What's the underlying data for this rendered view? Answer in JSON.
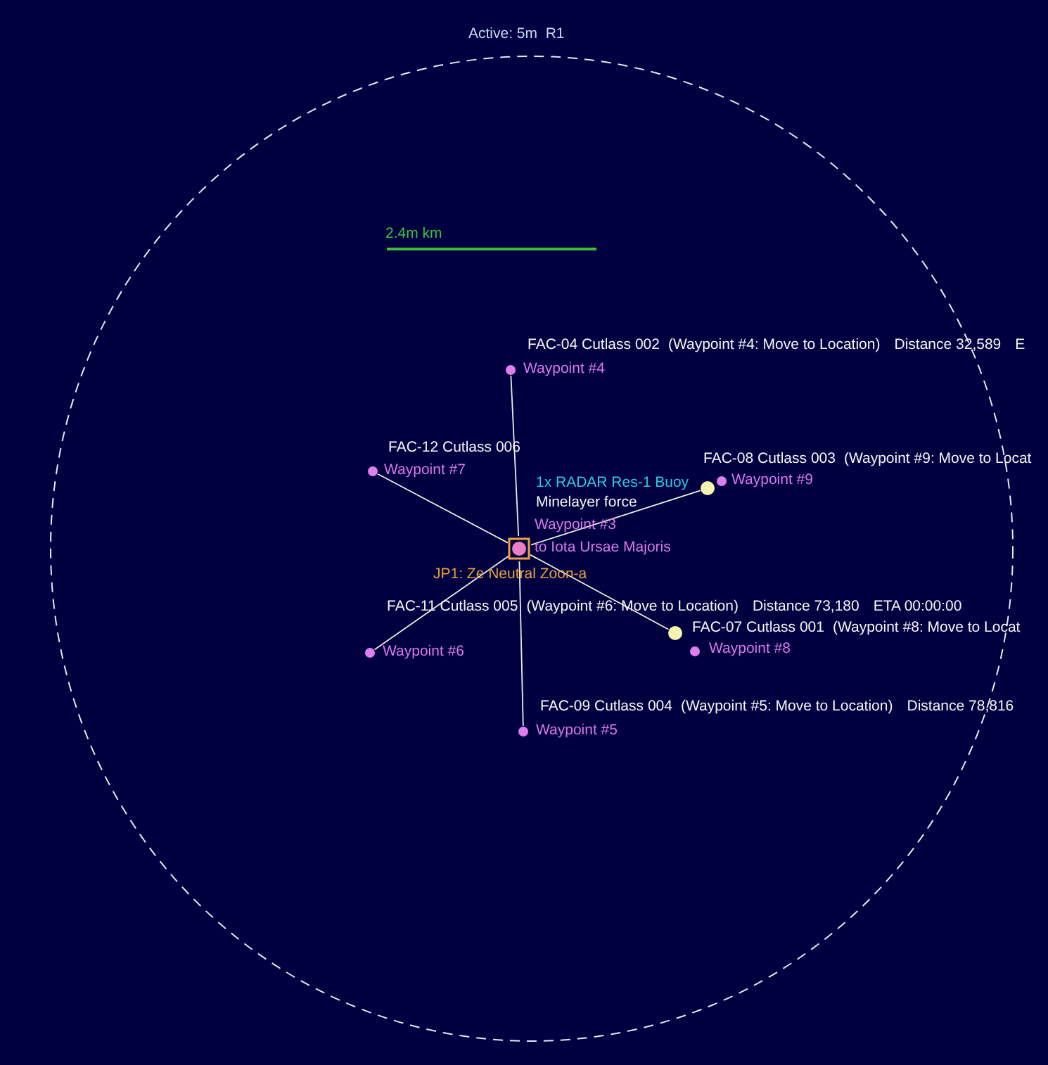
{
  "header": {
    "title": "Active: 5m  R1"
  },
  "scale_bar": {
    "label": "2.4m km"
  },
  "map": {
    "fleets": [
      {
        "name": "FAC-04 Cutlass 002",
        "order": "(Waypoint #4: Move to Location)",
        "distance": "Distance 32,589",
        "eta": "E"
      },
      {
        "name": "FAC-12 Cutlass 006"
      },
      {
        "name": "FAC-08 Cutlass 003",
        "order": "(Waypoint #9: Move to Locat"
      },
      {
        "name": "FAC-11 Cutlass 005",
        "order": "(Waypoint #6: Move to Location)",
        "distance": "Distance 73,180",
        "eta": "ETA 00:00:00"
      },
      {
        "name": "FAC-07 Cutlass 001",
        "order": "(Waypoint #8: Move to Locat"
      },
      {
        "name": "FAC-09 Cutlass 004",
        "order": "(Waypoint #5: Move to Location)",
        "distance": "Distance 78,816"
      }
    ],
    "waypoints": [
      {
        "label": "Waypoint #4"
      },
      {
        "label": "Waypoint #7"
      },
      {
        "label": "Waypoint #9"
      },
      {
        "label": "Waypoint #3",
        "destination": "to Iota Ursae Majoris"
      },
      {
        "label": "Waypoint #8"
      },
      {
        "label": "Waypoint #6"
      },
      {
        "label": "Waypoint #5"
      }
    ],
    "contacts": [
      {
        "kind": "sensor",
        "label": "1x RADAR Res-1 Buoy"
      }
    ],
    "task_group": {
      "label": "Minelayer force"
    },
    "jump_point": {
      "label": "JP1: Ze Neutral Zoon-a"
    }
  }
}
